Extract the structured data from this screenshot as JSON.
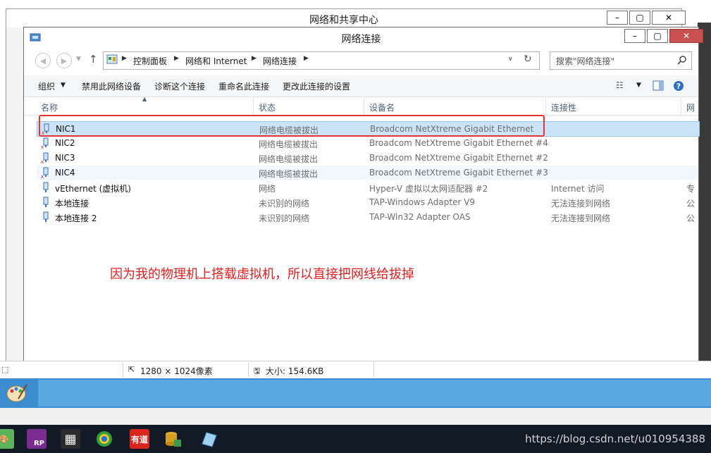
{
  "background_window": {
    "title": "网络和共享中心",
    "buttons": {
      "minimize": "–",
      "maximize": "▢",
      "close": "✕"
    }
  },
  "window": {
    "title": "网络连接",
    "buttons": {
      "minimize": "–",
      "maximize": "▢",
      "close": "✕"
    }
  },
  "address_bar": {
    "breadcrumbs": [
      "控制面板",
      "网络和 Internet",
      "网络连接"
    ],
    "search_placeholder": "搜索\"网络连接\""
  },
  "toolbar": {
    "organize": "组织",
    "disable": "禁用此网络设备",
    "diagnose": "诊断这个连接",
    "rename": "重命名此连接",
    "change_settings": "更改此连接的设置"
  },
  "columns": {
    "name": "名称",
    "status": "状态",
    "device": "设备名",
    "connectivity": "连接性",
    "network": "网"
  },
  "connections": [
    {
      "name": "NIC1",
      "status": "网络电缆被拔出",
      "device": "Broadcom NetXtreme Gigabit Ethernet",
      "connectivity": "",
      "network": "",
      "disconnected": true
    },
    {
      "name": "NIC2",
      "status": "网络电缆被拔出",
      "device": "Broadcom NetXtreme Gigabit Ethernet #4",
      "connectivity": "",
      "network": "",
      "disconnected": true
    },
    {
      "name": "NIC3",
      "status": "网络电缆被拔出",
      "device": "Broadcom NetXtreme Gigabit Ethernet #2",
      "connectivity": "",
      "network": "",
      "disconnected": true
    },
    {
      "name": "NIC4",
      "status": "网络电缆被拔出",
      "device": "Broadcom NetXtreme Gigabit Ethernet #3",
      "connectivity": "",
      "network": "",
      "disconnected": true
    },
    {
      "name": "vEthernet (虚拟机)",
      "status": "网络",
      "device": "Hyper-V 虚拟以太网适配器 #2",
      "connectivity": "Internet 访问",
      "network": "专",
      "disconnected": false
    },
    {
      "name": "本地连接",
      "status": "未识别的网络",
      "device": "TAP-Windows Adapter V9",
      "connectivity": "无法连接到网络",
      "network": "公",
      "disconnected": false
    },
    {
      "name": "本地连接 2",
      "status": "未识别的网络",
      "device": "TAP-Win32 Adapter OAS",
      "connectivity": "无法连接到网络",
      "network": "公",
      "disconnected": false
    }
  ],
  "annotation": "因为我的物理机上搭载虚拟机，所以直接把网线给拔掉",
  "status_bar": {
    "dimensions": "1280 × 1024像素",
    "size": "大小: 154.6KB"
  },
  "taskbar": {
    "icons": [
      "paint-icon",
      "axure-rp-icon",
      "calculator-icon",
      "browser-icon",
      "youdao-icon",
      "tool-icon",
      "notepad-icon"
    ],
    "rp_label": "RP",
    "youdao_label": "有道"
  },
  "watermark": "https://blog.csdn.net/u010954388",
  "colors": {
    "selection": "#cce4f7",
    "highlight_box": "#e53333",
    "annotation": "#e52020",
    "taskbar": "#121a26"
  }
}
